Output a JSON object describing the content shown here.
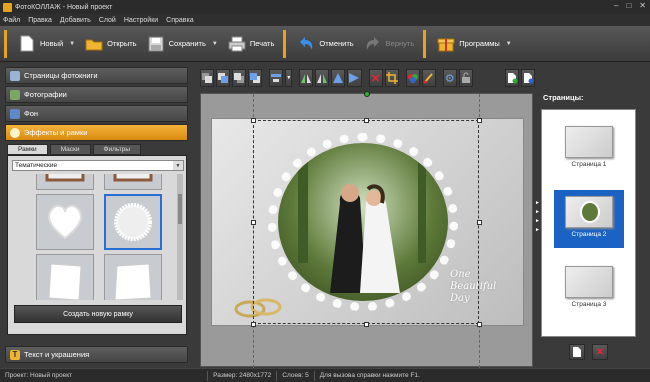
{
  "window": {
    "title": "ФотоКОЛЛАЖ - Новый проект"
  },
  "menu": [
    "Файл",
    "Правка",
    "Добавить",
    "Слой",
    "Настройки",
    "Справка"
  ],
  "toolbar": {
    "new": "Новый",
    "open": "Открыть",
    "save": "Сохранить",
    "print": "Печать",
    "undo": "Отменить",
    "redo": "Вернуть",
    "programs": "Программы"
  },
  "sidebar": {
    "sections": [
      "Страницы фотокниги",
      "Фотографии",
      "Фон",
      "Эффекты и рамки"
    ],
    "bottom_section": "Текст и украшения",
    "tabs": [
      "Рамки",
      "Маски",
      "Фильтры"
    ],
    "category": "Тематические",
    "new_frame": "Создать новую рамку"
  },
  "canvas": {
    "text_line1": "One",
    "text_line2": "Beautiful",
    "text_line3": "Day"
  },
  "pages_panel": {
    "title": "Страницы:",
    "pages": [
      "Страница 1",
      "Страница 2",
      "Страница 3"
    ],
    "selected": 1
  },
  "status": {
    "project": "Проект: Новый проект",
    "size": "Размер: 2480x1772",
    "layers": "Слоев: 5",
    "help": "Для вызова справки нажмите F1."
  },
  "colors": {
    "accent": "#e8a31e",
    "selection": "#1a62c4"
  }
}
